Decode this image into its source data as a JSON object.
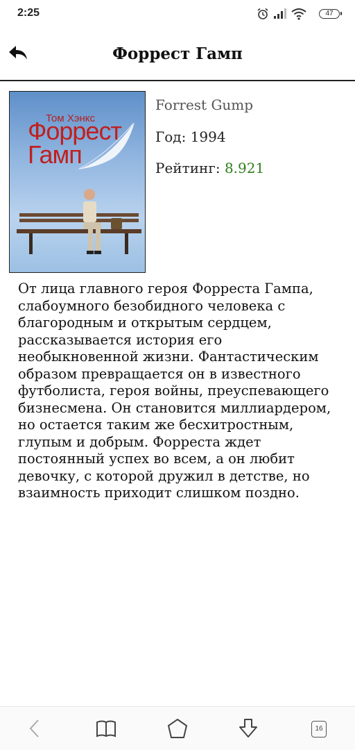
{
  "status_bar": {
    "time": "2:25",
    "battery": "47"
  },
  "app_bar": {
    "title": "Форрест Гамп"
  },
  "poster": {
    "actor": "Том Хэнкс",
    "title": "Форрест Гамп"
  },
  "movie": {
    "original_title": "Forrest Gump",
    "year_label": "Год:",
    "year": "1994",
    "rating_label": "Рейтинг:",
    "rating": "8.921",
    "description": "От лица главного героя Форреста Гампа, слабоумного безобидного человека с благородным и открытым сердцем, рассказывается история его необыкновенной жизни. Фантастическим образом превращается он в известного футболиста, героя войны, преуспевающего бизнесмена. Он становится миллиардером, но остается таким же бесхитростным, глупым и добрым. Форреста ждет постоянный успех во всем, а он любит девочку, с которой дружил в детстве, но взаимность приходит слишком поздно."
  },
  "nav_bar": {
    "tab_count": "16"
  },
  "colors": {
    "rating": "#2e7d1a",
    "divider": "#222222"
  }
}
